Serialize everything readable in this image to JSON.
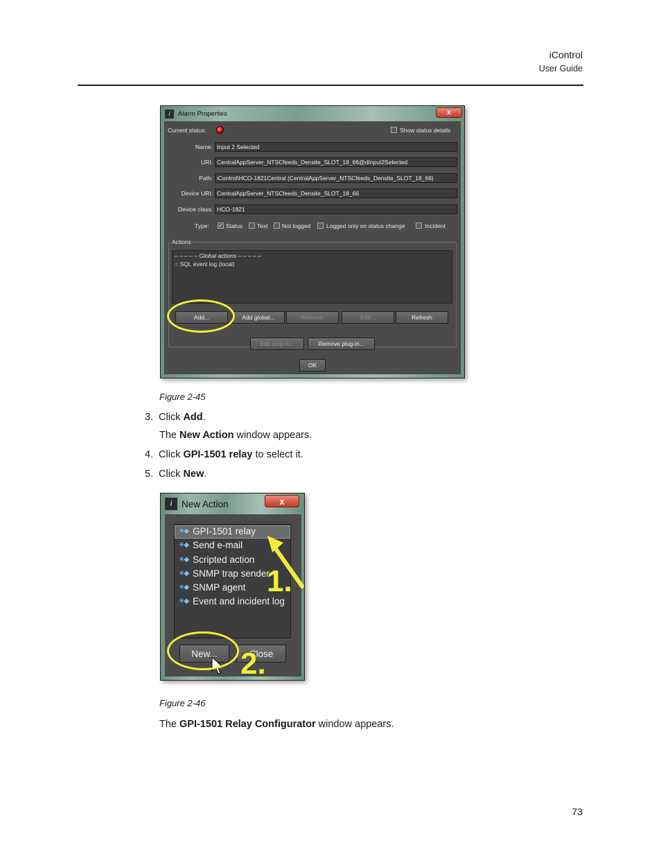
{
  "header": {
    "title": "iControl",
    "subtitle": "User Guide"
  },
  "figure1": {
    "caption": "Figure 2-45",
    "window_title": "Alarm Properties",
    "close_label": "x",
    "current_status_label": "Current status:",
    "show_status_details": "Show status details",
    "fields": [
      {
        "label": "Name:",
        "value": "Input 2 Selected"
      },
      {
        "label": "URI:",
        "value": "CentralAppServer_NTSCfeeds_Densite_SLOT_18_66@dInput2Selected"
      },
      {
        "label": "Path:",
        "value": "iControl\\HCO-1821Central (CentralAppServer_NTSCfeeds_Densite_SLOT_18_66)"
      },
      {
        "label": "Device URI:",
        "value": "CentralAppServer_NTSCfeeds_Densite_SLOT_18_66"
      },
      {
        "label": "Device class:",
        "value": "HCO-1821"
      }
    ],
    "type_label": "Type:",
    "type_options": [
      {
        "label": "Status",
        "checked": true
      },
      {
        "label": "Text",
        "checked": false
      },
      {
        "label": "Not logged",
        "checked": false
      },
      {
        "label": "Logged only on status change",
        "checked": false
      },
      {
        "label": "Incident",
        "checked": false
      }
    ],
    "actions_legend": "Actions",
    "global_actions": "Global actions",
    "action_item": "SQL event log (local)",
    "buttons": {
      "add": "Add...",
      "add_global": "Add global...",
      "remove": "Remove",
      "edit": "Edit...",
      "refresh": "Refresh",
      "edit_plugin": "Edit plug-in...",
      "remove_plugin": "Remove plug-in...",
      "ok": "OK"
    }
  },
  "steps": [
    {
      "num": "3.",
      "pre": "Click ",
      "bold": "Add",
      "post": "."
    },
    {
      "num": "4.",
      "pre": "Click ",
      "bold": "GPI-1501 relay",
      "post": " to select it."
    },
    {
      "num": "5.",
      "pre": "Click ",
      "bold": "New",
      "post": "."
    }
  ],
  "step3_result": {
    "pre": "The ",
    "bold": "New Action",
    "post": " window appears."
  },
  "figure2": {
    "caption": "Figure 2-46",
    "window_title": "New Action",
    "close_label": "x",
    "items": [
      "GPI-1501 relay",
      "Send e-mail",
      "Scripted action",
      "SNMP trap sender",
      "SNMP agent",
      "Event and incident log"
    ],
    "buttons": {
      "new": "New...",
      "close": "Close"
    },
    "callout1": "1.",
    "callout2": "2."
  },
  "final": {
    "pre": "The ",
    "bold": "GPI-1501 Relay Configurator",
    "post": " window appears."
  },
  "page_number": "73"
}
